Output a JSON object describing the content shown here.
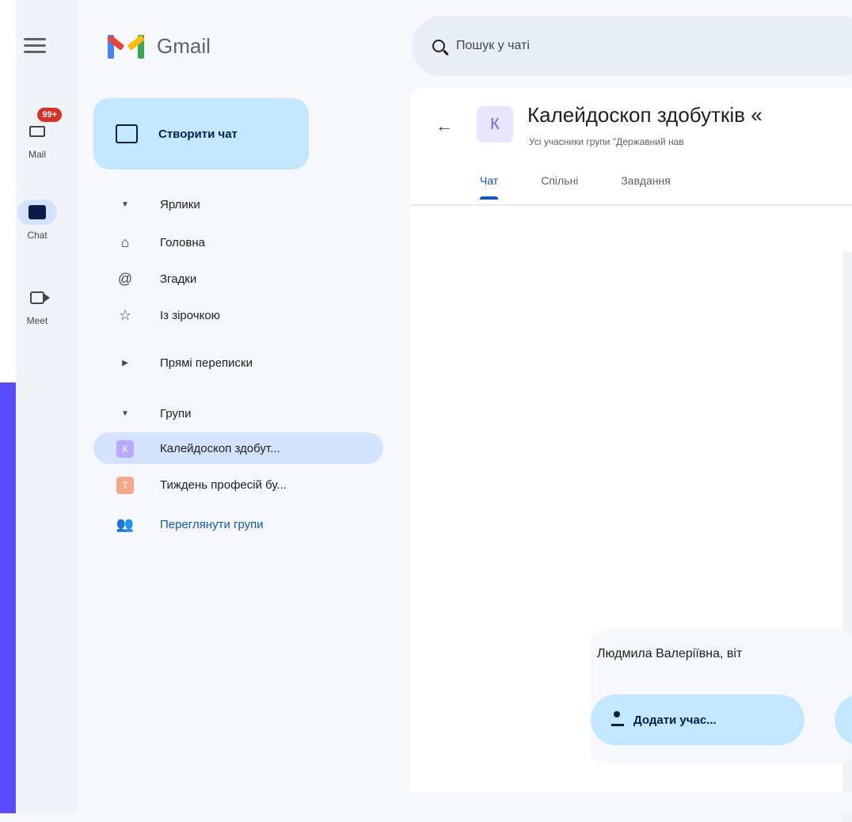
{
  "app": {
    "name": "Gmail"
  },
  "rail": {
    "items": [
      {
        "label": "Mail",
        "badge": "99+",
        "icon": "mail-icon"
      },
      {
        "label": "Chat",
        "icon": "chat-icon",
        "active": true
      },
      {
        "label": "Meet",
        "icon": "meet-icon"
      }
    ]
  },
  "compose": {
    "label": "Створити чат"
  },
  "nav": {
    "shortcuts_header": "Ярлики",
    "home": "Головна",
    "mentions": "Згадки",
    "starred": "Із зірочкою",
    "dm_header": "Прямі переписки",
    "spaces_header": "Групи",
    "spaces": [
      {
        "initial": "К",
        "name": "Калейдоскоп здобут...",
        "color": "#b8a9ff"
      },
      {
        "initial": "Т",
        "name": "Тиждень професій бу...",
        "color": "#f1a98a"
      }
    ],
    "browse": "Переглянути групи"
  },
  "search": {
    "placeholder": "Пошук у чаті"
  },
  "room": {
    "avatar": "К",
    "title": "Калейдоскоп здобутків «",
    "subtitle": "Усі учасники групи \"Державний нав",
    "tabs": [
      "Чат",
      "Спільні",
      "Завдання"
    ]
  },
  "welcome": {
    "text": "Людмила Валеріївна, віт",
    "add_button": "Додати учас..."
  },
  "colors": {
    "accent": "#0b57d0",
    "compose_bg": "#c2e7ff",
    "selected": "#d3e3fd",
    "badge": "#d93025"
  }
}
